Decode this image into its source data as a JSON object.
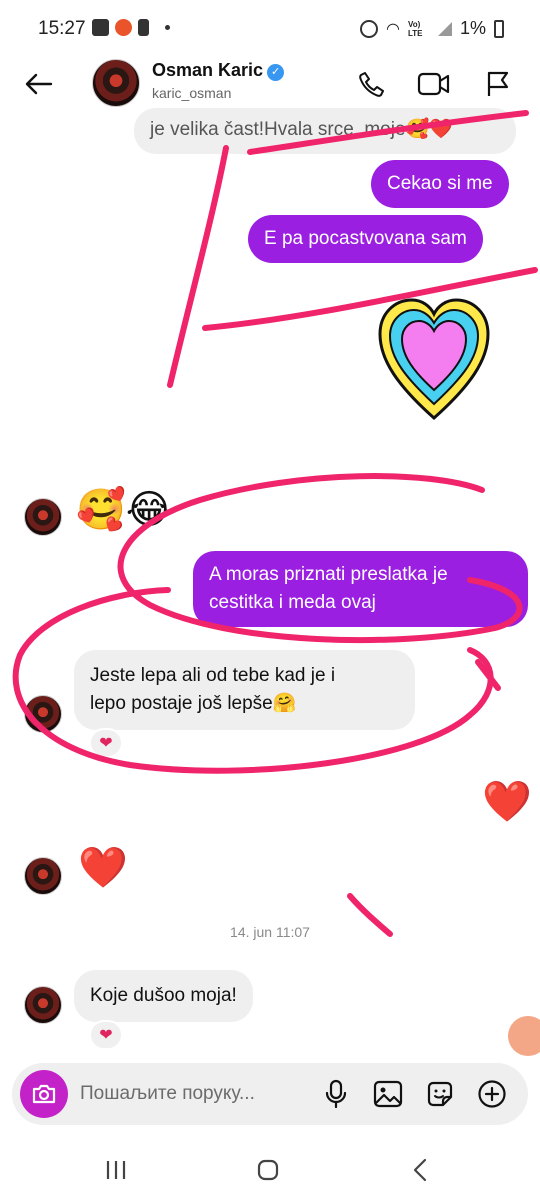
{
  "status_bar": {
    "time": "15:27",
    "battery": "1%",
    "network_label": "Vo) LTE"
  },
  "header": {
    "name": "Osman Karic",
    "username": "karic_osman",
    "verified": true
  },
  "messages": {
    "m0": {
      "text": "je velika čast!Hvala srce..moje🥰❤️"
    },
    "m1": {
      "text": "Cekao si me"
    },
    "m2": {
      "text": "E pa pocastvovana sam"
    },
    "m3": {
      "emoji": "🥰😂"
    },
    "m4": {
      "line1": "A moras priznati preslatka je",
      "line2": "cestitka i meda ovaj"
    },
    "m5": {
      "line1": "Jeste lepa ali od tebe kad je i",
      "line2": "lepo postaje još lepše🤗",
      "reaction": "❤"
    },
    "m6": {
      "emoji": "❤️"
    },
    "m7": {
      "emoji": "❤️"
    },
    "timestamp": "14. jun 11:07",
    "m8": {
      "text": "Koje dušoo moja!",
      "reaction": "❤"
    }
  },
  "composer": {
    "placeholder": "Пошаљите поруку..."
  },
  "colors": {
    "outgoing_bubble": "#9b1fe0",
    "incoming_bubble": "#efefef",
    "scribble": "#f0246a",
    "camera_button": "#c422c9"
  },
  "icons": [
    "back-arrow-icon",
    "phone-icon",
    "video-icon",
    "flag-icon",
    "camera-icon",
    "microphone-icon",
    "gallery-icon",
    "sticker-icon",
    "plus-icon"
  ]
}
